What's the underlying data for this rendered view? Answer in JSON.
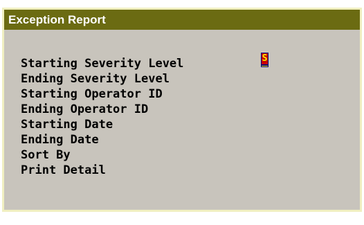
{
  "window": {
    "title": "Exception Report"
  },
  "form": {
    "fields": [
      {
        "label": "Starting Severity Level"
      },
      {
        "label": "Ending Severity Level"
      },
      {
        "label": "Starting Operator ID"
      },
      {
        "label": "Ending Operator ID"
      },
      {
        "label": "Starting Date"
      },
      {
        "label": "Ending Date"
      },
      {
        "label": "Sort By"
      },
      {
        "label": "Print Detail"
      }
    ],
    "active_field": {
      "value": "S"
    }
  },
  "colors": {
    "titlebar_bg": "#6b6b12",
    "titlebar_text": "#ffffff",
    "window_border": "#f0efc0",
    "form_bg": "#c8c4bc",
    "input_bg": "#f5f000",
    "input_char_bg": "#c80000"
  }
}
